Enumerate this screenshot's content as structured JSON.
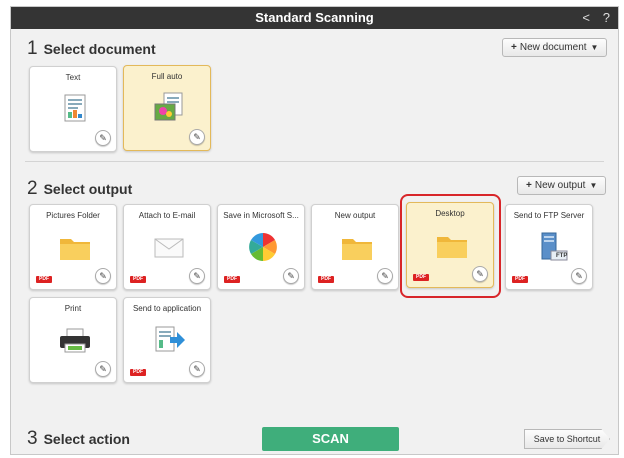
{
  "window": {
    "title": "Standard Scanning",
    "back_glyph": "<",
    "help_glyph": "?"
  },
  "sections": {
    "document": {
      "num": "1",
      "title": "Select document"
    },
    "output": {
      "num": "2",
      "title": "Select output"
    },
    "action": {
      "num": "3",
      "title": "Select action"
    }
  },
  "buttons": {
    "new_document": "New document",
    "new_output": "New output",
    "scan": "SCAN",
    "save_shortcut": "Save to Shortcut",
    "plus": "+",
    "caret": "▼",
    "edit": "✎"
  },
  "document_cards": [
    {
      "label": "Text",
      "icon": "text-document-icon",
      "selected": false
    },
    {
      "label": "Full auto",
      "icon": "photo-document-icon",
      "selected": true
    }
  ],
  "output_cards": [
    {
      "label": "Pictures Folder",
      "icon": "folder-icon",
      "badge": "PDF",
      "selected": false
    },
    {
      "label": "Attach to E-mail",
      "icon": "envelope-icon",
      "badge": "PDF",
      "selected": false
    },
    {
      "label": "Save in Microsoft S...",
      "icon": "sharepoint-icon",
      "badge": "PDF",
      "selected": false
    },
    {
      "label": "New output",
      "icon": "folder-icon",
      "badge": "PDF",
      "selected": false
    },
    {
      "label": "Desktop",
      "icon": "folder-icon",
      "badge": "PDF",
      "selected": true
    },
    {
      "label": "Send to FTP Server",
      "icon": "ftp-server-icon",
      "badge": "PDF",
      "selected": false
    },
    {
      "label": "Print",
      "icon": "printer-icon",
      "badge": "",
      "selected": false
    },
    {
      "label": "Send to application",
      "icon": "send-to-app-icon",
      "badge": "PDF",
      "selected": false
    }
  ],
  "ftp_label": "FTP",
  "colors": {
    "title_bar": "#343434",
    "scan_green": "#3fae7b",
    "selected_fill": "#fbf1cd",
    "highlight_red": "#d8262a",
    "pdf_red": "#dd2222"
  }
}
